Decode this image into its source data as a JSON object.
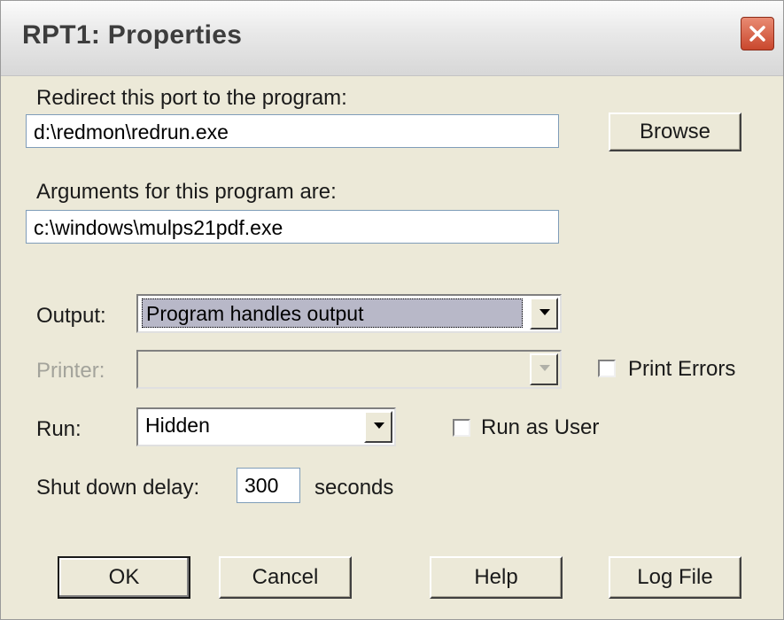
{
  "window": {
    "title": "RPT1: Properties"
  },
  "redirect": {
    "label": "Redirect this port to the program:",
    "value": "d:\\redmon\\redrun.exe",
    "browse_label": "Browse"
  },
  "arguments": {
    "label": "Arguments for this program are:",
    "value": "c:\\windows\\mulps21pdf.exe"
  },
  "output": {
    "label": "Output:",
    "value": "Program handles output"
  },
  "printer": {
    "label": "Printer:",
    "value": "",
    "print_errors_label": "Print Errors",
    "print_errors_checked": false
  },
  "run": {
    "label": "Run:",
    "value": "Hidden",
    "run_as_user_label": "Run as User",
    "run_as_user_checked": false
  },
  "shutdown": {
    "label": "Shut down delay:",
    "value": "300",
    "unit": "seconds"
  },
  "buttons": {
    "ok": "OK",
    "cancel": "Cancel",
    "help": "Help",
    "log_file": "Log File"
  },
  "icons": {
    "close": "close-icon",
    "dropdown": "chevron-down-icon"
  },
  "colors": {
    "close_button": "#c9472d",
    "selection": "#b8b8c8",
    "dialog_bg": "#ece9d8"
  }
}
